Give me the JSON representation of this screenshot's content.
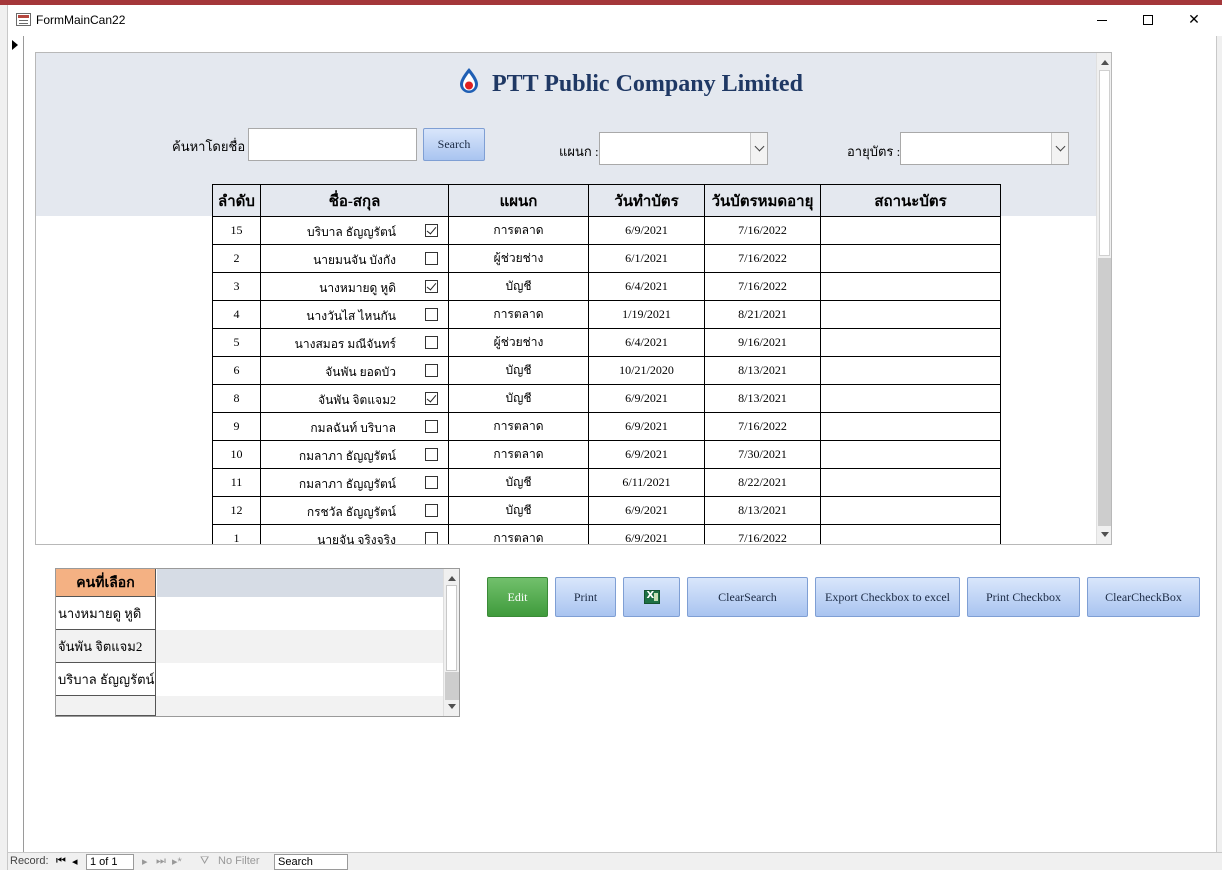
{
  "window": {
    "title": "FormMainCan22"
  },
  "header": {
    "company_name": "PTT Public Company Limited"
  },
  "filters": {
    "search_label": "ค้นหาโดยชื่อ :",
    "search_value": "",
    "search_button": "Search",
    "department_label": "แผนก :",
    "department_value": "",
    "expiry_label": "อายุบัตร :",
    "expiry_value": ""
  },
  "grid": {
    "columns": [
      "ลำดับ",
      "ชื่อ-สกุล",
      "แผนก",
      "วันทำบัตร",
      "วันบัตรหมดอายุ",
      "สถานะบัตร"
    ],
    "rows": [
      {
        "no": "15",
        "name": "บริบาล ธัญญรัตน์",
        "checked": true,
        "dept": "การตลาด",
        "issued": "6/9/2021",
        "expires": "7/16/2022",
        "status": ""
      },
      {
        "no": "2",
        "name": "นายมนจัน บังกัง",
        "checked": false,
        "dept": "ผู้ช่วยช่าง",
        "issued": "6/1/2021",
        "expires": "7/16/2022",
        "status": ""
      },
      {
        "no": "3",
        "name": "นางหมายดู หูดิ",
        "checked": true,
        "dept": "บัญชี",
        "issued": "6/4/2021",
        "expires": "7/16/2022",
        "status": ""
      },
      {
        "no": "4",
        "name": "นางวันไส ไหนกัน",
        "checked": false,
        "dept": "การตลาด",
        "issued": "1/19/2021",
        "expires": "8/21/2021",
        "status": ""
      },
      {
        "no": "5",
        "name": "นางสมอร มณีจันทร์",
        "checked": false,
        "dept": "ผู้ช่วยช่าง",
        "issued": "6/4/2021",
        "expires": "9/16/2021",
        "status": ""
      },
      {
        "no": "6",
        "name": "จันพัน ยอดบัว",
        "checked": false,
        "dept": "บัญชี",
        "issued": "10/21/2020",
        "expires": "8/13/2021",
        "status": ""
      },
      {
        "no": "8",
        "name": "จันพัน จิตแจม2",
        "checked": true,
        "dept": "บัญชี",
        "issued": "6/9/2021",
        "expires": "8/13/2021",
        "status": ""
      },
      {
        "no": "9",
        "name": "กมลฉันท์ บริบาล",
        "checked": false,
        "dept": "การตลาด",
        "issued": "6/9/2021",
        "expires": "7/16/2022",
        "status": ""
      },
      {
        "no": "10",
        "name": "กมลาภา ธัญญรัตน์",
        "checked": false,
        "dept": "การตลาด",
        "issued": "6/9/2021",
        "expires": "7/30/2021",
        "status": ""
      },
      {
        "no": "11",
        "name": "กมลาภา ธัญญรัตน์",
        "checked": false,
        "dept": "บัญชี",
        "issued": "6/11/2021",
        "expires": "8/22/2021",
        "status": ""
      },
      {
        "no": "12",
        "name": "กรชวัล ธัญญรัตน์",
        "checked": false,
        "dept": "บัญชี",
        "issued": "6/9/2021",
        "expires": "8/13/2021",
        "status": ""
      },
      {
        "no": "1",
        "name": "นายจัน จริงจริง",
        "checked": false,
        "dept": "การตลาด",
        "issued": "6/9/2021",
        "expires": "7/16/2022",
        "status": ""
      }
    ]
  },
  "selected_panel": {
    "header": "คนที่เลือก",
    "items": [
      "นางหมายดู หูดิ",
      "จันพัน จิตแจม2",
      "บริบาล ธัญญรัตน์",
      ""
    ]
  },
  "buttons": {
    "edit": "Edit",
    "print": "Print",
    "excel_icon": "excel-icon",
    "clear_search": "ClearSearch",
    "export_checkbox": "Export Checkbox to excel",
    "print_checkbox": "Print Checkbox",
    "clear_checkbox": "ClearCheckBox"
  },
  "navigation": {
    "record_label": "Record:",
    "record_value": "1 of 1",
    "filter_label": "No Filter",
    "search_label": "Search"
  },
  "colors": {
    "title_bar_accent": "#a4373a",
    "company_text": "#1f3864",
    "header_band": "#e4e8ef",
    "selected_header": "#f4b183",
    "edit_button": "#4ca249",
    "blue_button": "#a9c4f0"
  }
}
